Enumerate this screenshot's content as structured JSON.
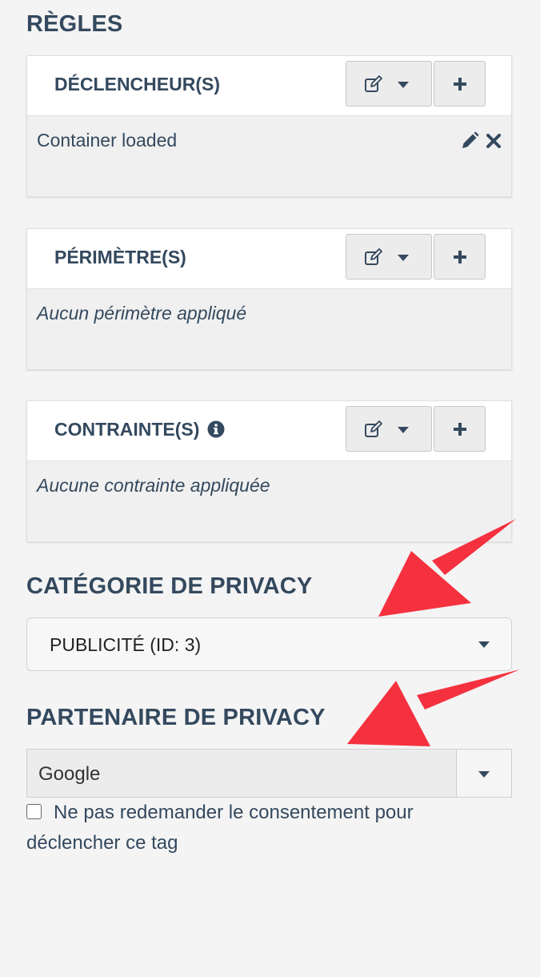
{
  "rules_section": {
    "title": "RÈGLES"
  },
  "triggers": {
    "title": "DÉCLENCHEUR(S)",
    "items": [
      {
        "label": "Container loaded"
      }
    ]
  },
  "scopes": {
    "title": "PÉRIMÈTRE(S)",
    "empty_text": "Aucun périmètre appliqué"
  },
  "constraints": {
    "title": "CONTRAINTE(S)",
    "empty_text": "Aucune contrainte appliquée"
  },
  "privacy_category": {
    "title": "CATÉGORIE DE PRIVACY",
    "selected": "PUBLICITÉ (ID: 3)"
  },
  "privacy_partner": {
    "title": "PARTENAIRE DE PRIVACY",
    "selected": "Google"
  },
  "consent_checkbox": {
    "label": "Ne pas redemander le consentement pour déclencher ce tag",
    "checked": false
  },
  "colors": {
    "text": "#34495e",
    "annotation_arrow": "#f5313f",
    "panel_bg": "#f4f4f4"
  }
}
